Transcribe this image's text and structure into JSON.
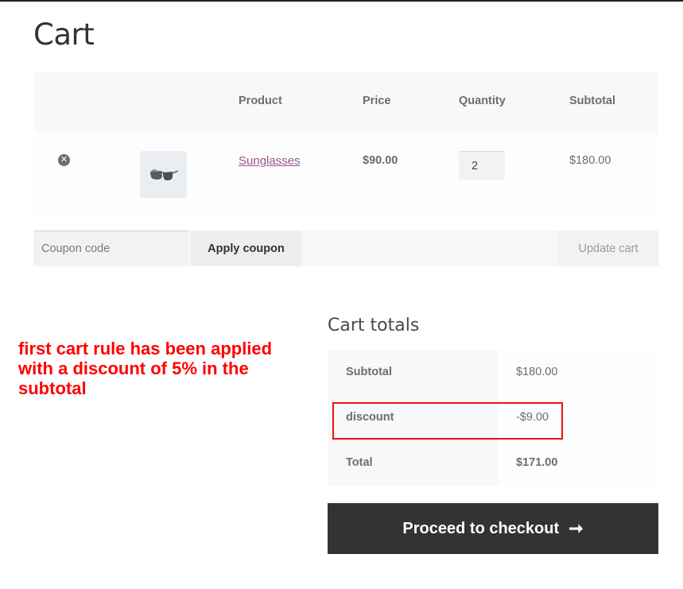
{
  "page": {
    "title": "Cart"
  },
  "cart_table": {
    "headers": {
      "product": "Product",
      "price": "Price",
      "quantity": "Quantity",
      "subtotal": "Subtotal"
    },
    "items": [
      {
        "remove_icon": "remove-circle-x-icon",
        "remove_glyph": "✕",
        "thumbnail": "sunglasses-image",
        "name": "Sunglasses",
        "price": "$90.00",
        "quantity": "2",
        "subtotal": "$180.00"
      }
    ]
  },
  "actions": {
    "coupon_placeholder": "Coupon code",
    "apply_coupon_label": "Apply coupon",
    "update_cart_label": "Update cart"
  },
  "annotation": {
    "text": "first cart rule has been applied with a discount of 5% in the subtotal",
    "color": "#ff0000"
  },
  "cart_totals": {
    "title": "Cart totals",
    "rows": [
      {
        "label": "Subtotal",
        "value": "$180.00"
      },
      {
        "label": "discount",
        "value": "-$9.00"
      },
      {
        "label": "Total",
        "value": "$171.00"
      }
    ]
  },
  "checkout": {
    "label": "Proceed to checkout",
    "icon": "arrow-right-icon",
    "glyph": "➞"
  },
  "colors": {
    "link": "#96588a",
    "button_dark": "#333333",
    "highlight": "#ee1111"
  }
}
